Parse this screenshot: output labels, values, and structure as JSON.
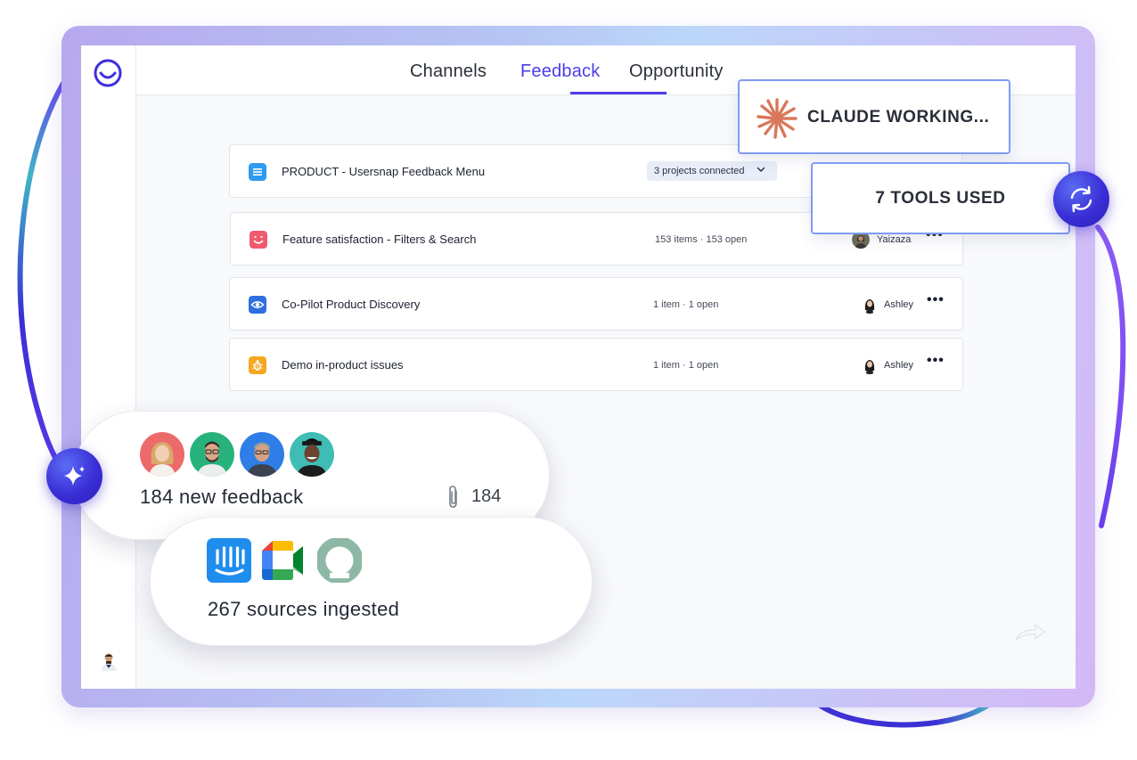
{
  "tabs": [
    {
      "label": "Channels",
      "active": false
    },
    {
      "label": "Feedback",
      "active": true
    },
    {
      "label": "Opportunity",
      "active": false
    }
  ],
  "status_cards": {
    "working": "CLAUDE WORKING...",
    "tools": "7 TOOLS USED"
  },
  "projects": [
    {
      "title": "PRODUCT - Usersnap Feedback Menu",
      "connected": "3 projects connected",
      "owner": "",
      "icon": "list-icon",
      "icon_color": "#2f9bf0"
    },
    {
      "title": "Feature satisfaction - Filters & Search",
      "meta": "153 items · 153 open",
      "owner": "Yaizaza",
      "icon": "smile-hearts-icon",
      "icon_color": "#ef5a6f"
    },
    {
      "title": "Co-Pilot Product Discovery",
      "meta": "1 item · 1 open",
      "owner": "Ashley",
      "icon": "eye-icon",
      "icon_color": "#2f6fe0"
    },
    {
      "title": "Demo in-product issues",
      "meta": "1 item · 1 open",
      "owner": "Ashley",
      "icon": "bug-icon",
      "icon_color": "#f5a623"
    }
  ],
  "feedback_bubble": {
    "text": "184 new feedback",
    "attachments": "184"
  },
  "sources_bubble": {
    "text": "267 sources ingested",
    "sources": [
      "intercom-icon",
      "google-meet-icon",
      "openai-icon"
    ]
  },
  "colors": {
    "accent": "#4c3de8",
    "orbit_blue": "#3a2fd6",
    "orbit_teal": "#3fb4c4",
    "frame_border": "#b8b6f2",
    "card_border": "#7f9bf2"
  }
}
